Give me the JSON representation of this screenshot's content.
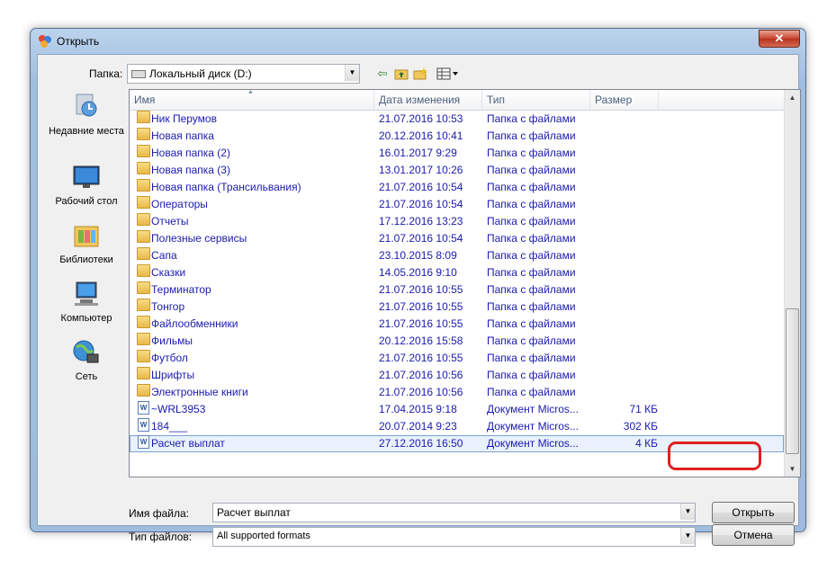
{
  "window": {
    "title": "Открыть",
    "close_label": "✕"
  },
  "toolbar": {
    "folder_label": "Папка:",
    "folder_value": "Локальный диск (D:)",
    "tools": [
      {
        "name": "back-icon",
        "glyph": "⇦"
      },
      {
        "name": "up-folder-icon",
        "glyph": "▣"
      },
      {
        "name": "new-folder-icon",
        "glyph": "✱"
      },
      {
        "name": "view-menu-icon",
        "glyph": "▦▾"
      }
    ]
  },
  "places": [
    {
      "label": "Недавние места",
      "icon": "recent-places-icon"
    },
    {
      "label": "Рабочий стол",
      "icon": "desktop-icon"
    },
    {
      "label": "Библиотеки",
      "icon": "libraries-icon"
    },
    {
      "label": "Компьютер",
      "icon": "computer-icon"
    },
    {
      "label": "Сеть",
      "icon": "network-icon"
    }
  ],
  "columns": [
    "Имя",
    "Дата изменения",
    "Тип",
    "Размер"
  ],
  "files": [
    {
      "name": "Ник Перумов",
      "date": "21.07.2016 10:53",
      "type": "Папка с файлами",
      "size": "",
      "kind": "folder"
    },
    {
      "name": "Новая папка",
      "date": "20.12.2016 10:41",
      "type": "Папка с файлами",
      "size": "",
      "kind": "folder"
    },
    {
      "name": "Новая папка (2)",
      "date": "16.01.2017 9:29",
      "type": "Папка с файлами",
      "size": "",
      "kind": "folder"
    },
    {
      "name": "Новая папка (3)",
      "date": "13.01.2017 10:26",
      "type": "Папка с файлами",
      "size": "",
      "kind": "folder"
    },
    {
      "name": "Новая папка (Трансильвания)",
      "date": "21.07.2016 10:54",
      "type": "Папка с файлами",
      "size": "",
      "kind": "folder"
    },
    {
      "name": "Операторы",
      "date": "21.07.2016 10:54",
      "type": "Папка с файлами",
      "size": "",
      "kind": "folder"
    },
    {
      "name": "Отчеты",
      "date": "17.12.2016 13:23",
      "type": "Папка с файлами",
      "size": "",
      "kind": "folder"
    },
    {
      "name": "Полезные сервисы",
      "date": "21.07.2016 10:54",
      "type": "Папка с файлами",
      "size": "",
      "kind": "folder"
    },
    {
      "name": "Сапа",
      "date": "23.10.2015 8:09",
      "type": "Папка с файлами",
      "size": "",
      "kind": "folder"
    },
    {
      "name": "Сказки",
      "date": "14.05.2016 9:10",
      "type": "Папка с файлами",
      "size": "",
      "kind": "folder"
    },
    {
      "name": "Терминатор",
      "date": "21.07.2016 10:55",
      "type": "Папка с файлами",
      "size": "",
      "kind": "folder"
    },
    {
      "name": "Тонгор",
      "date": "21.07.2016 10:55",
      "type": "Папка с файлами",
      "size": "",
      "kind": "folder"
    },
    {
      "name": "Файлообменники",
      "date": "21.07.2016 10:55",
      "type": "Папка с файлами",
      "size": "",
      "kind": "folder"
    },
    {
      "name": "Фильмы",
      "date": "20.12.2016 15:58",
      "type": "Папка с файлами",
      "size": "",
      "kind": "folder"
    },
    {
      "name": "Футбол",
      "date": "21.07.2016 10:55",
      "type": "Папка с файлами",
      "size": "",
      "kind": "folder"
    },
    {
      "name": "Шрифты",
      "date": "21.07.2016 10:56",
      "type": "Папка с файлами",
      "size": "",
      "kind": "folder"
    },
    {
      "name": "Электронные книги",
      "date": "21.07.2016 10:56",
      "type": "Папка с файлами",
      "size": "",
      "kind": "folder"
    },
    {
      "name": "~WRL3953",
      "date": "17.04.2015 9:18",
      "type": "Документ Micros...",
      "size": "71 КБ",
      "kind": "doc"
    },
    {
      "name": "184___",
      "date": "20.07.2014 9:23",
      "type": "Документ Micros...",
      "size": "302 КБ",
      "kind": "doc"
    },
    {
      "name": "Расчет выплат",
      "date": "27.12.2016 16:50",
      "type": "Документ Micros...",
      "size": "4 КБ",
      "kind": "doc",
      "selected": true
    }
  ],
  "form": {
    "filename_label": "Имя файла:",
    "filename_value": "Расчет выплат",
    "filetype_label": "Тип файлов:",
    "filetype_value": "All supported formats",
    "open_label": "Открыть",
    "cancel_label": "Отмена"
  },
  "colors": {
    "link_text": "#1a1ab0",
    "highlight": "#e02020"
  }
}
